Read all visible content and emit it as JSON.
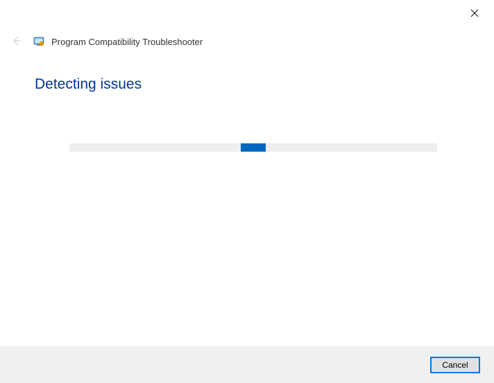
{
  "window": {
    "title": "Program Compatibility Troubleshooter"
  },
  "main": {
    "heading": "Detecting issues"
  },
  "footer": {
    "cancel_label": "Cancel"
  }
}
